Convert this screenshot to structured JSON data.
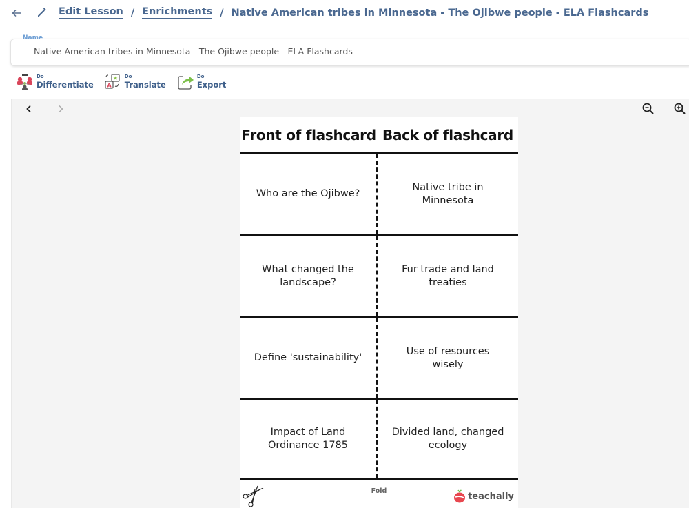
{
  "header": {
    "breadcrumbs": [
      {
        "label": "Edit Lesson",
        "link": true
      },
      {
        "label": "Enrichments",
        "link": true
      },
      {
        "label": "Native American tribes in Minnesota - The Ojibwe people - ELA Flashcards",
        "link": false
      }
    ],
    "separator": "/",
    "icons": {
      "back": "arrow-left-icon",
      "edit": "pencil-icon"
    }
  },
  "name_field": {
    "label": "Name",
    "value": "Native American tribes in Minnesota - The Ojibwe people - ELA Flashcards"
  },
  "actions": [
    {
      "prefix": "Do",
      "label": "Differentiate",
      "icon": "differentiate-icon"
    },
    {
      "prefix": "Do",
      "label": "Translate",
      "icon": "translate-icon"
    },
    {
      "prefix": "Do",
      "label": "Export",
      "icon": "export-icon"
    }
  ],
  "viewer": {
    "nav_prev": "‹",
    "nav_next": "›",
    "zoom_out_icon": "zoom-out-icon",
    "zoom_in_icon": "zoom-in-icon"
  },
  "flashcards": {
    "front_header": "Front of flashcard",
    "back_header": "Back of flashcard",
    "cards": [
      {
        "front": "Who are the Ojibwe?",
        "back": "Native tribe in Minnesota"
      },
      {
        "front": "What changed the landscape?",
        "back": "Fur trade and land treaties"
      },
      {
        "front": "Define 'sustainability'",
        "back": "Use of resources wisely"
      },
      {
        "front": "Impact of Land Ordinance 1785",
        "back": "Divided land, changed ecology"
      }
    ],
    "fold_label": "Fold",
    "brand": "teachally",
    "colors": {
      "brand_red": "#e8474f",
      "brand_green": "#6cbf4a",
      "link_blue": "#4a6890"
    }
  }
}
